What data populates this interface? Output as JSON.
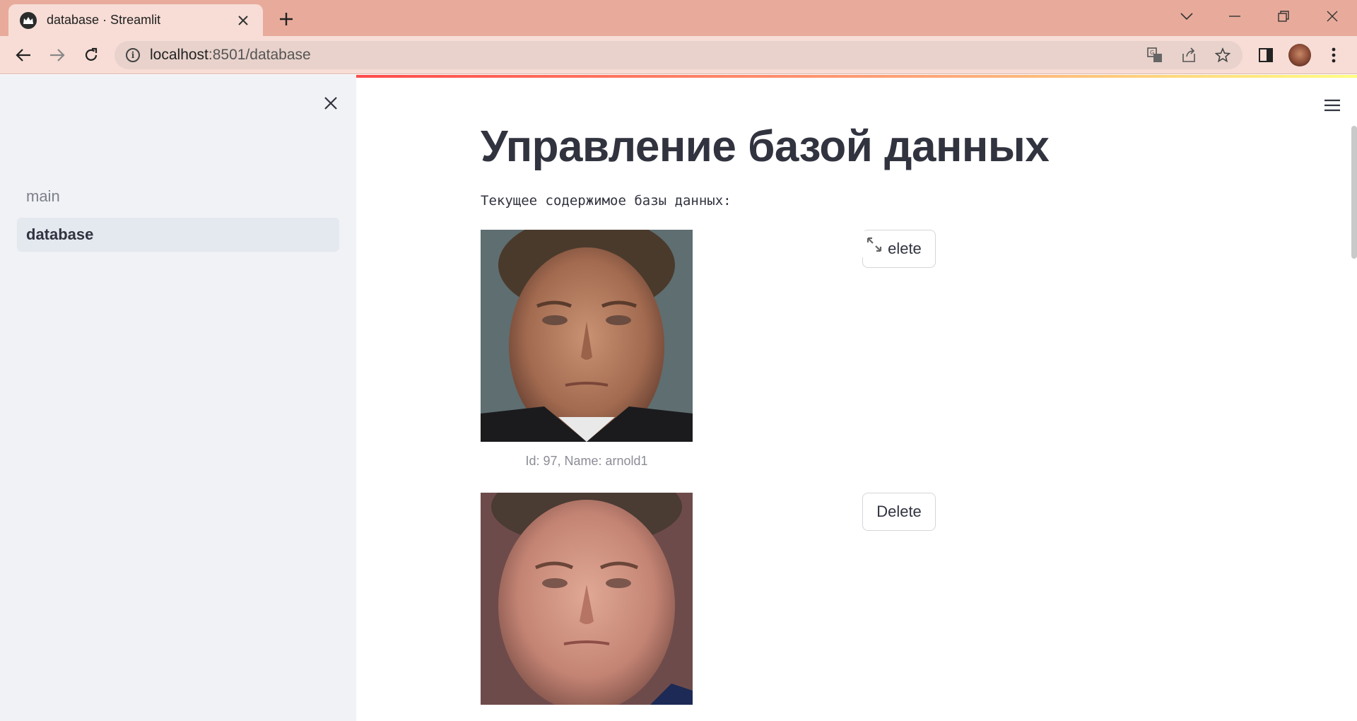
{
  "browser": {
    "tab_title": "database · Streamlit",
    "url_host": "localhost",
    "url_path": ":8501/database"
  },
  "sidebar": {
    "items": [
      {
        "label": "main",
        "active": false
      },
      {
        "label": "database",
        "active": true
      }
    ]
  },
  "main": {
    "title": "Управление базой данных",
    "subtitle": "Текущее содержимое базы данных:",
    "entries": [
      {
        "caption": "Id: 97, Name: arnold1",
        "delete_label": "Delete"
      },
      {
        "caption": "",
        "delete_label": "Delete"
      }
    ]
  },
  "colors": {
    "tabbar": "#e8ab9b",
    "toolbar": "#f7ddd6",
    "sidebar_bg": "#f0f2f6",
    "text_primary": "#31333f",
    "accent_red": "#ff4b4b"
  },
  "icons": [
    "streamlit-favicon",
    "close-tab-icon",
    "new-tab-icon",
    "chevron-down-icon",
    "minimize-icon",
    "restore-icon",
    "close-window-icon",
    "back-arrow-icon",
    "forward-arrow-icon",
    "reload-icon",
    "info-icon",
    "translate-icon",
    "share-icon",
    "star-icon",
    "side-panel-icon",
    "more-menu-icon",
    "close-sidebar-icon",
    "hamburger-menu-icon",
    "expand-icon"
  ]
}
